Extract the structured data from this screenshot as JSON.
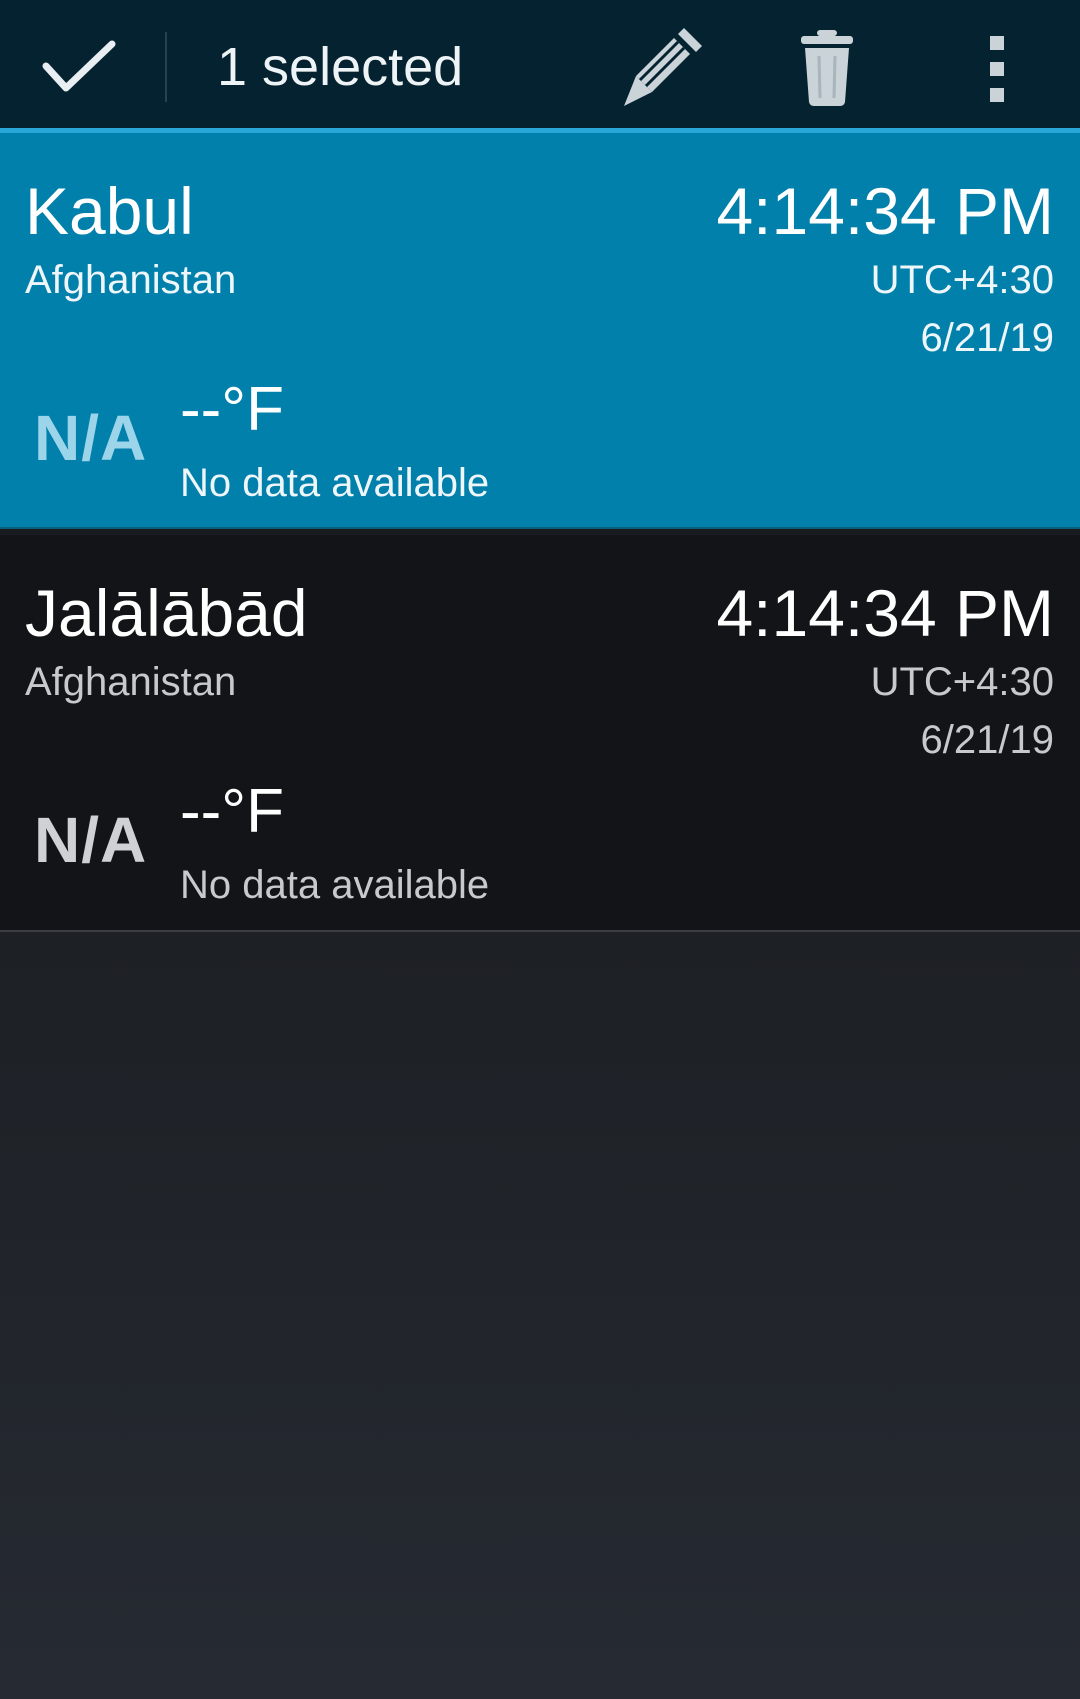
{
  "action_bar": {
    "selected_label": "1 selected",
    "icons": [
      "check-icon",
      "pencil-icon",
      "trash-icon",
      "more-vert-icon"
    ]
  },
  "cities": [
    {
      "name": "Kabul",
      "country": "Afghanistan",
      "time": "4:14:34 PM",
      "utc_offset": "UTC+4:30",
      "date": "6/21/19",
      "weather_icon": "N/A",
      "temperature": "--°F",
      "condition": "No data available",
      "selected": true
    },
    {
      "name": "Jalālābād",
      "country": "Afghanistan",
      "time": "4:14:34 PM",
      "utc_offset": "UTC+4:30",
      "date": "6/21/19",
      "weather_icon": "N/A",
      "temperature": "--°F",
      "condition": "No data available",
      "selected": false
    }
  ],
  "colors": {
    "action_bar_bg": "#04222f",
    "accent": "#2aa6d9",
    "selected_row_bg": "#0080ab",
    "row_bg": "#131417"
  }
}
